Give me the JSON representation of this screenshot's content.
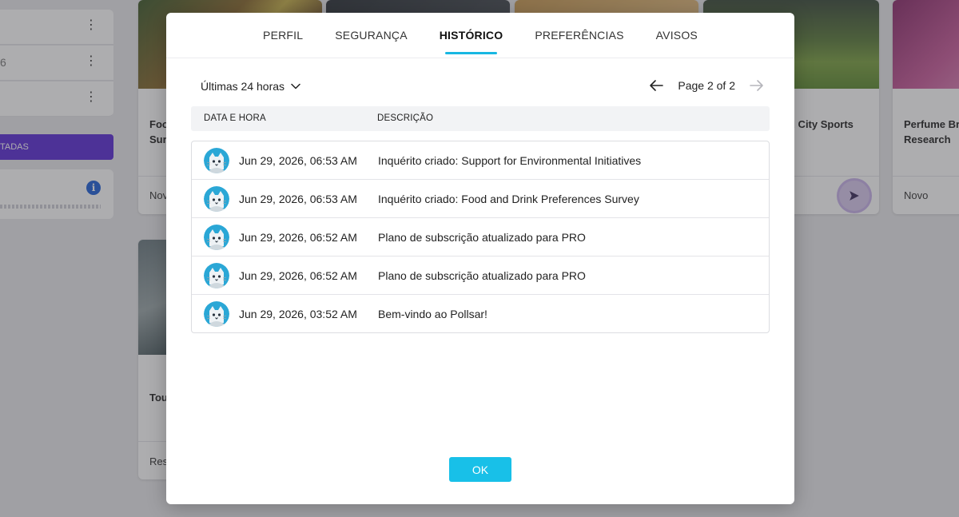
{
  "background": {
    "sidebar": {
      "row_number": "6",
      "button_label": "TADAS"
    },
    "cards": [
      {
        "title": "Foo\nSur",
        "footer": "Nov"
      },
      {
        "title": "d City Sports",
        "footer": ""
      },
      {
        "title": "Perfume Br\nResearch",
        "footer": "Novo"
      },
      {
        "title": "Tou",
        "footer": "Res"
      }
    ]
  },
  "modal": {
    "tabs": [
      {
        "label": "PERFIL"
      },
      {
        "label": "SEGURANÇA"
      },
      {
        "label": "HISTÓRICO"
      },
      {
        "label": "PREFERÊNCIAS"
      },
      {
        "label": "AVISOS"
      }
    ],
    "active_tab": "HISTÓRICO",
    "filter": {
      "label": "Últimas 24 horas",
      "icon": "chevron-down-icon"
    },
    "pagination": {
      "text": "Page 2 of 2"
    },
    "table": {
      "columns": [
        "DATA E HORA",
        "DESCRIÇÃO"
      ],
      "rows": [
        {
          "datetime": "Jun 29, 2026, 06:53 AM",
          "description": "Inquérito criado: Support for Environmental Initiatives"
        },
        {
          "datetime": "Jun 29, 2026, 06:53 AM",
          "description": "Inquérito criado: Food and Drink Preferences Survey"
        },
        {
          "datetime": "Jun 29, 2026, 06:52 AM",
          "description": "Plano de subscrição atualizado para PRO"
        },
        {
          "datetime": "Jun 29, 2026, 06:52 AM",
          "description": "Plano de subscrição atualizado para PRO"
        },
        {
          "datetime": "Jun 29, 2026, 03:52 AM",
          "description": "Bem-vindo ao Pollsar!"
        }
      ]
    },
    "ok_label": "OK"
  },
  "colors": {
    "accent": "#18c0e8",
    "tab_underline": "#18b7e2",
    "sidebar_button": "#5b2bd6",
    "info_icon": "#1e5fd8"
  }
}
